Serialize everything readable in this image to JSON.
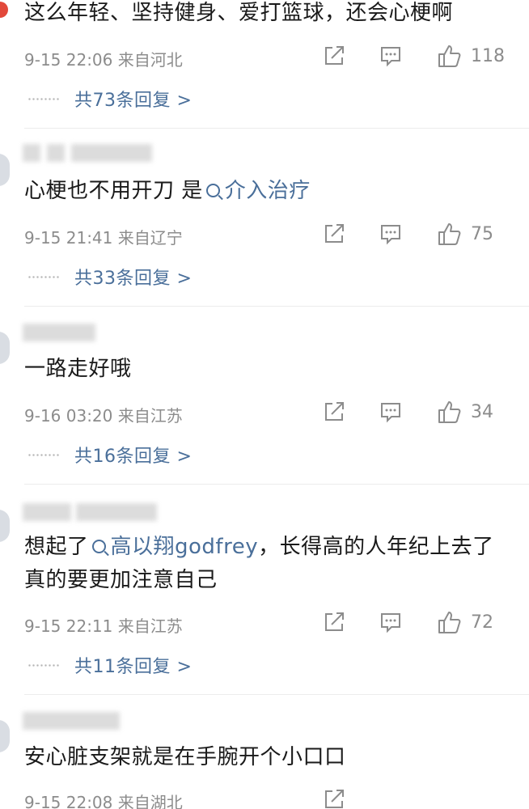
{
  "comments": [
    {
      "text": "这么年轻、坚持健身、爱打篮球，还会心梗啊",
      "meta": "9-15 22:06 来自河北",
      "likes": "118",
      "replies": "共73条回复 >"
    },
    {
      "text_before": "心梗也不用开刀 是",
      "topic": "介入治疗",
      "meta": "9-15 21:41 来自辽宁",
      "likes": "75",
      "replies": "共33条回复 >"
    },
    {
      "text": "一路走好哦",
      "meta": "9-16 03:20 来自江苏",
      "likes": "34",
      "replies": "共16条回复 >"
    },
    {
      "text_before": "想起了",
      "topic": "高以翔godfrey",
      "text_after": "，长得高的人年纪上去了真的要更加注意自己",
      "meta": "9-15 22:11 来自江苏",
      "likes": "72",
      "replies": "共11条回复 >"
    },
    {
      "text": "安心脏支架就是在手腕开个小口口",
      "meta": "9-15 22:08 来自湖北"
    }
  ],
  "icons": {
    "share": "share-icon",
    "comment": "comment-icon",
    "like": "thumbs-up-icon"
  },
  "colors": {
    "link": "#4a6f9a",
    "meta": "#8c8c8c",
    "text": "#1a1a1a"
  }
}
